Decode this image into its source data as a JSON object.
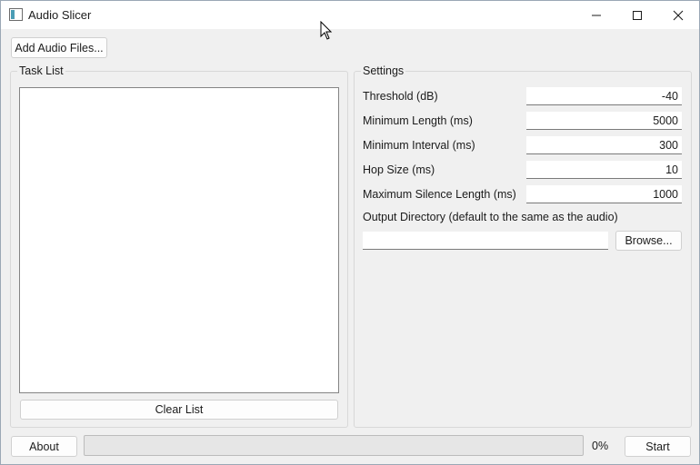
{
  "window": {
    "title": "Audio Slicer",
    "controls": {
      "minimize_icon": "minimize-icon",
      "maximize_icon": "maximize-icon",
      "close_icon": "close-icon"
    }
  },
  "toolbar": {
    "add_files_label": "Add Audio Files..."
  },
  "task_list": {
    "title": "Task List",
    "items": [],
    "clear_label": "Clear List"
  },
  "settings": {
    "title": "Settings",
    "fields": [
      {
        "label": "Threshold (dB)",
        "value": "-40"
      },
      {
        "label": "Minimum Length (ms)",
        "value": "5000"
      },
      {
        "label": "Minimum Interval (ms)",
        "value": "300"
      },
      {
        "label": "Hop Size (ms)",
        "value": "10"
      },
      {
        "label": "Maximum Silence Length (ms)",
        "value": "1000"
      }
    ],
    "output_dir_label": "Output Directory (default to the same as the audio)",
    "output_dir_value": "",
    "browse_label": "Browse..."
  },
  "footer": {
    "about_label": "About",
    "progress": 0,
    "progress_text": "0%",
    "start_label": "Start"
  },
  "colors": {
    "progress_fill": "#06b025",
    "window_bg": "#f0f0f0"
  }
}
